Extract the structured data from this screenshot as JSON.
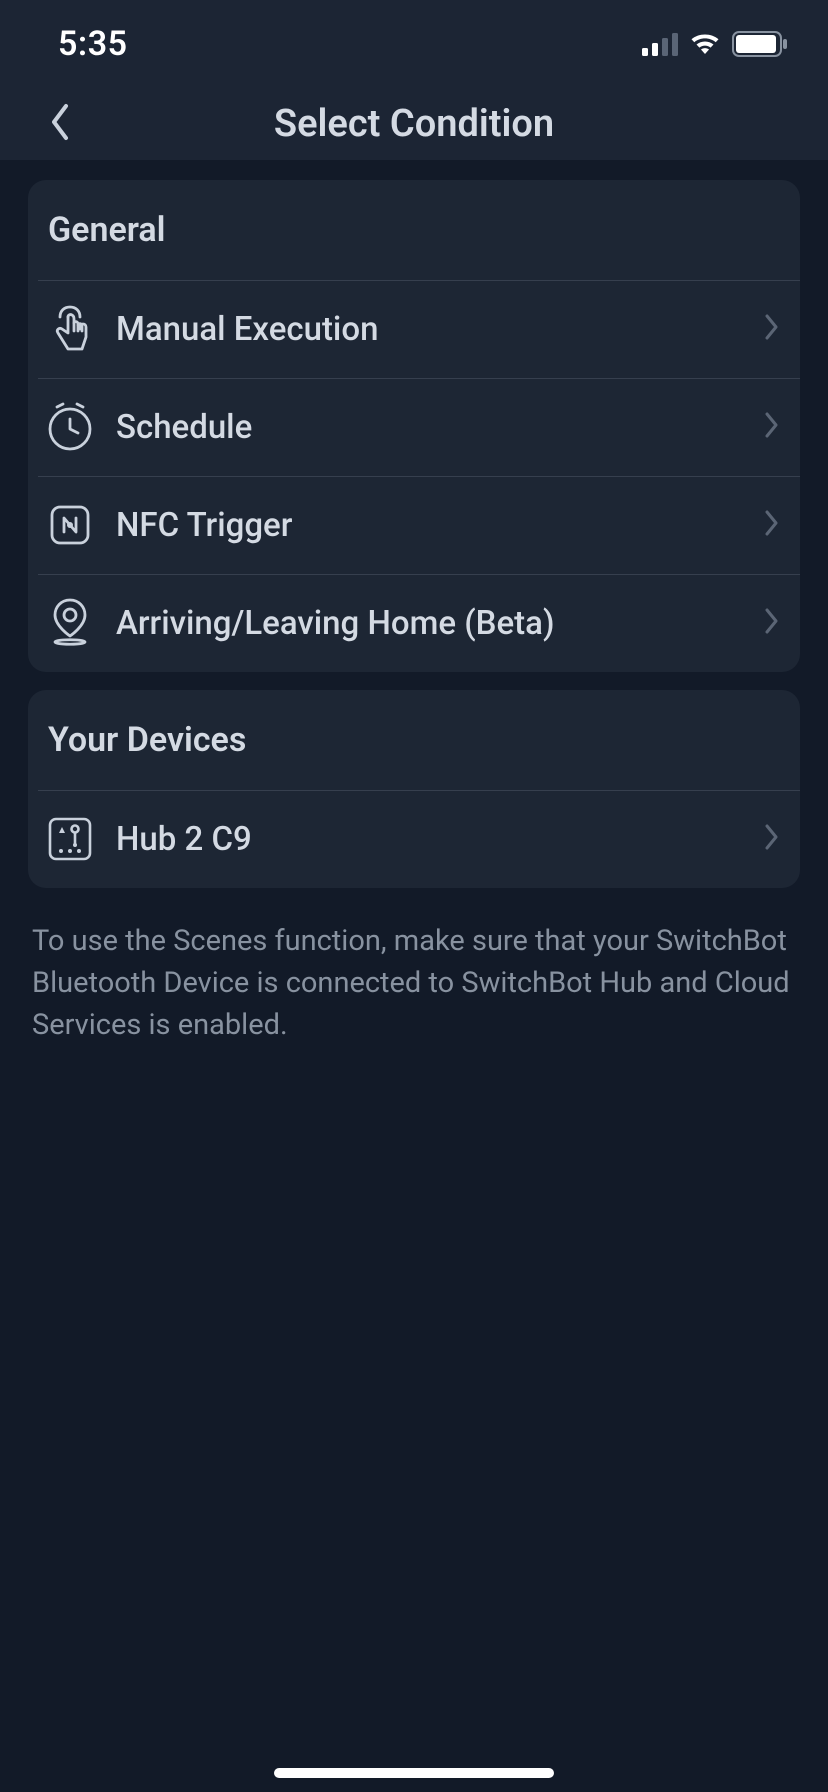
{
  "status": {
    "time": "5:35"
  },
  "nav": {
    "title": "Select Condition"
  },
  "sections": {
    "general": {
      "title": "General",
      "items": [
        {
          "label": "Manual Execution"
        },
        {
          "label": "Schedule"
        },
        {
          "label": "NFC Trigger"
        },
        {
          "label": "Arriving/Leaving Home (Beta)"
        }
      ]
    },
    "devices": {
      "title": "Your Devices",
      "items": [
        {
          "label": "Hub 2 C9"
        }
      ]
    }
  },
  "footer_note": "To use the Scenes function, make sure that your SwitchBot Bluetooth Device is connected to SwitchBot Hub and Cloud Services is enabled."
}
